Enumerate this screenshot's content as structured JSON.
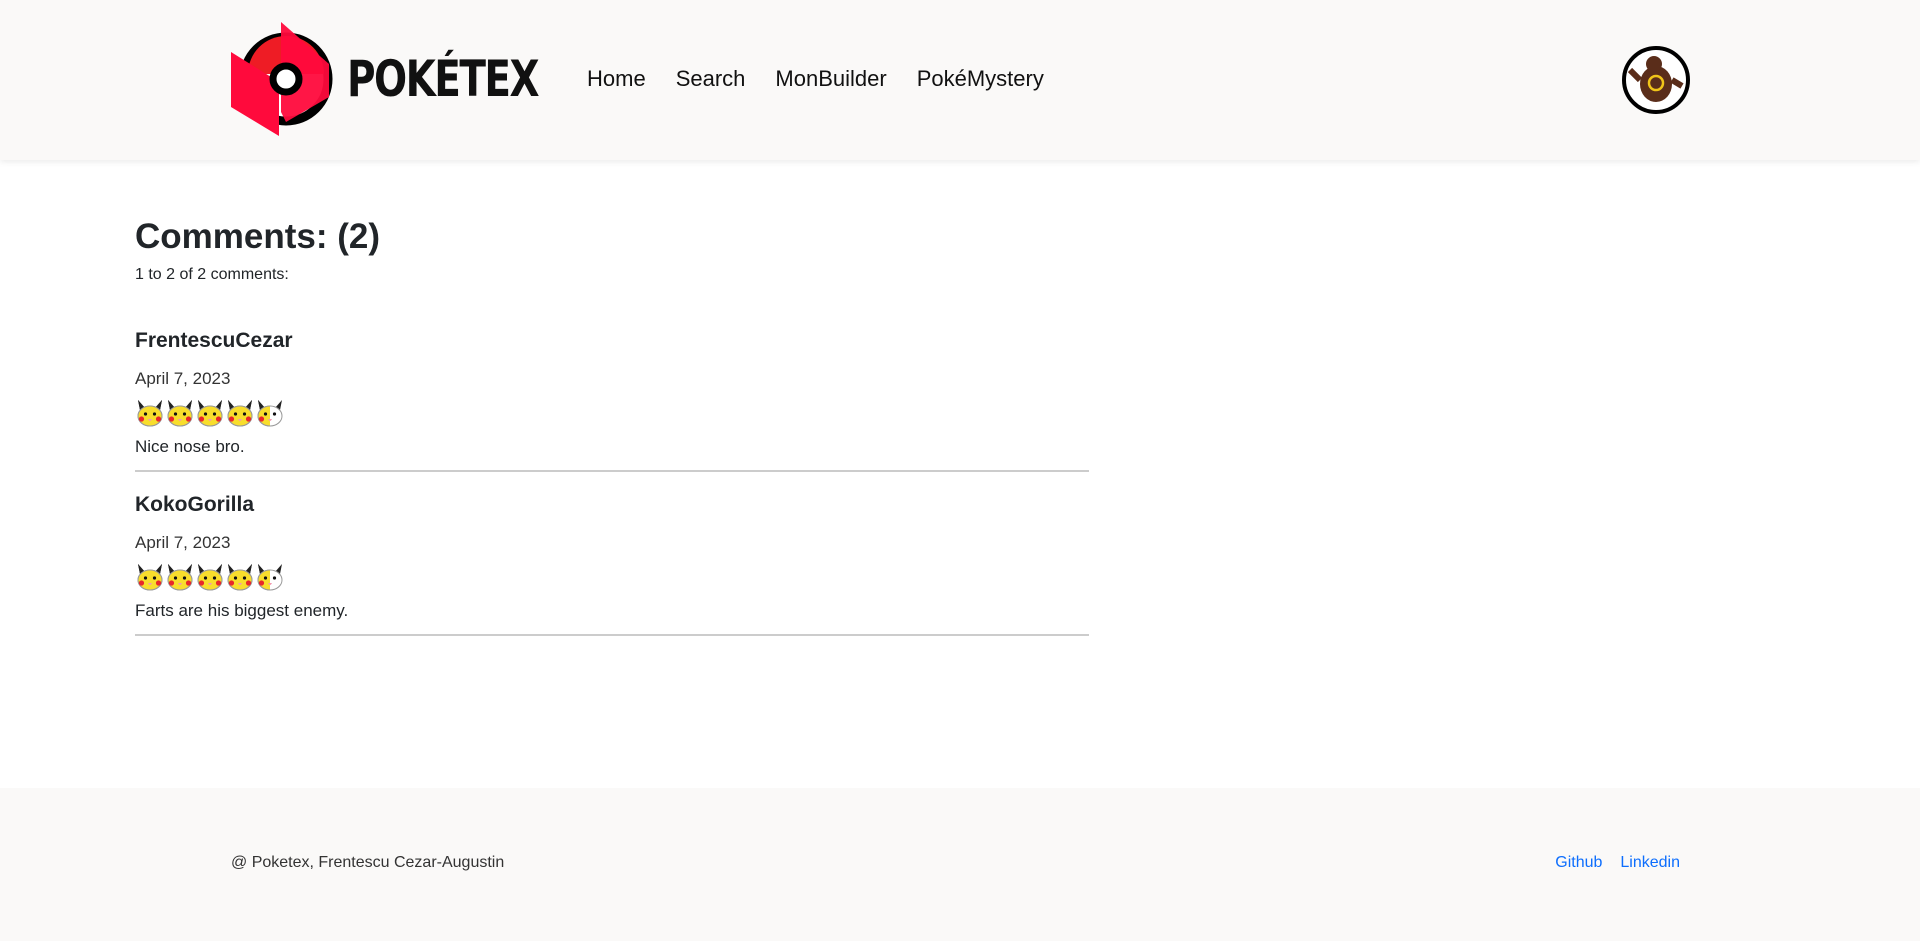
{
  "header": {
    "brand": "POKÉTEX",
    "nav": [
      "Home",
      "Search",
      "MonBuilder",
      "PokéMystery"
    ],
    "avatar_icon": "ursaring-avatar"
  },
  "main": {
    "title": "Comments: (2)",
    "summary": "1 to 2 of 2 comments:",
    "comments": [
      {
        "author": "FrentescuCezar",
        "date": "April 7, 2023",
        "rating": 4.5,
        "rating_max": 5,
        "text": "Nice nose bro."
      },
      {
        "author": "KokoGorilla",
        "date": "April 7, 2023",
        "rating": 4.5,
        "rating_max": 5,
        "text": "Farts are his biggest enemy."
      }
    ]
  },
  "footer": {
    "copyright": "@ Poketex, Frentescu Cezar-Augustin",
    "links": [
      "Github",
      "Linkedin"
    ]
  },
  "colors": {
    "brand_red": "#ff0a3c",
    "link": "#0d6efd",
    "header_bg": "#faf9f8"
  }
}
